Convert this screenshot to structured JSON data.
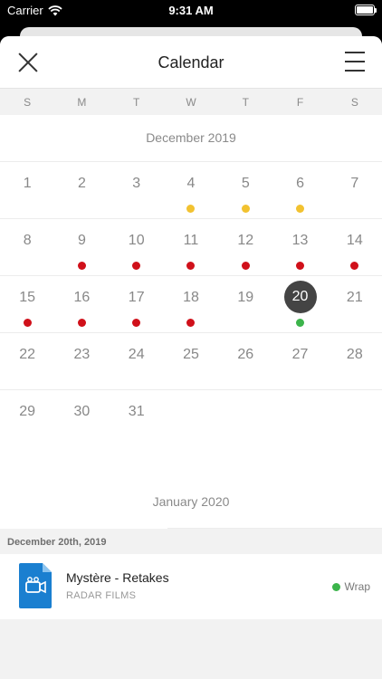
{
  "status_bar": {
    "carrier": "Carrier",
    "time": "9:31 AM"
  },
  "nav": {
    "title": "Calendar",
    "close_icon": "close-icon",
    "menu_icon": "hamburger-menu-icon"
  },
  "weekdays": [
    "S",
    "M",
    "T",
    "W",
    "T",
    "F",
    "S"
  ],
  "month": {
    "title": "December 2019",
    "weeks": [
      [
        {
          "n": "1"
        },
        {
          "n": "2"
        },
        {
          "n": "3"
        },
        {
          "n": "4",
          "dot": "yellow"
        },
        {
          "n": "5",
          "dot": "yellow"
        },
        {
          "n": "6",
          "dot": "yellow"
        },
        {
          "n": "7"
        }
      ],
      [
        {
          "n": "8"
        },
        {
          "n": "9",
          "dot": "red"
        },
        {
          "n": "10",
          "dot": "red"
        },
        {
          "n": "11",
          "dot": "red"
        },
        {
          "n": "12",
          "dot": "red"
        },
        {
          "n": "13",
          "dot": "red"
        },
        {
          "n": "14",
          "dot": "red"
        }
      ],
      [
        {
          "n": "15",
          "dot": "red"
        },
        {
          "n": "16",
          "dot": "red"
        },
        {
          "n": "17",
          "dot": "red"
        },
        {
          "n": "18",
          "dot": "red"
        },
        {
          "n": "19"
        },
        {
          "n": "20",
          "dot": "green",
          "selected": true
        },
        {
          "n": "21"
        }
      ],
      [
        {
          "n": "22"
        },
        {
          "n": "23"
        },
        {
          "n": "24"
        },
        {
          "n": "25"
        },
        {
          "n": "26"
        },
        {
          "n": "27"
        },
        {
          "n": "28"
        }
      ],
      [
        {
          "n": "29"
        },
        {
          "n": "30"
        },
        {
          "n": "31"
        },
        {
          "n": ""
        },
        {
          "n": ""
        },
        {
          "n": ""
        },
        {
          "n": ""
        }
      ]
    ]
  },
  "next_month": {
    "title": "January 2020"
  },
  "events_section": {
    "date_header": "December 20th, 2019",
    "events": [
      {
        "title": "Mystère - Retakes",
        "company": "RADAR FILMS",
        "status": "Wrap",
        "status_color": "#3cb44b",
        "icon": "video-file-icon"
      }
    ]
  },
  "colors": {
    "yellow_dot": "#f2c230",
    "red_dot": "#d0101a",
    "green_dot": "#3cb44b",
    "selected_day": "#444444",
    "file_icon_blue": "#1a7fd0"
  }
}
